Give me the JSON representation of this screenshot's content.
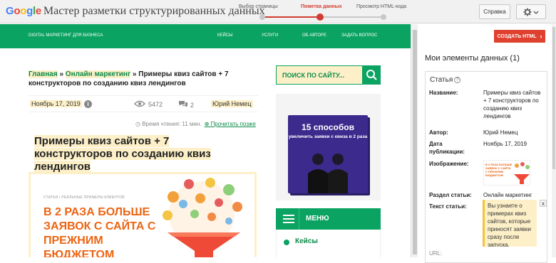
{
  "topbar": {
    "brand_google": "Google",
    "brand_title": "Мастер разметки структурированных данных",
    "steps": [
      "Выбор страницы",
      "Пометка данных",
      "Просмотр HTML-кода"
    ],
    "help_label": "Справка",
    "active_color": "#d23c30"
  },
  "site": {
    "nav": [
      "DIGITAL МАРКЕТИНГ ДЛЯ БИЗНЕСА",
      "КЕЙСЫ",
      "УСЛУГИ",
      "ОБ АВТОРЕ",
      "ЗАДАТЬ ВОПРОС"
    ],
    "brand_color": "#0ba361",
    "breadcrumb": {
      "home": "Главная",
      "sep1": " » ",
      "category": "Онлайн маркетинг",
      "sep2": " » ",
      "current": "Примеры квиз сайтов + 7 конструкторов по созданию квиз лендингов"
    },
    "meta": {
      "date": "Ноябрь 17, 2019",
      "views": "5472",
      "comments": "2",
      "author": "Юрий Немец"
    },
    "read_time": "Время чтения: 11 мин.",
    "read_later": "Прочитать позже",
    "article_title": "Примеры квиз сайтов + 7 конструкторов по созданию квиз лендингов",
    "hero": {
      "kicker": "СТАТЬЯ • РЕАЛЬНЫЕ ПРИМЕРЫ КЛИЕНТОВ",
      "headline": "В 2 РАЗА БОЛЬШЕ ЗАЯВОК С САЙТА С ПРЕЖНИМ БЮДЖЕТОМ"
    },
    "search_placeholder": "ПОИСК ПО САЙТУ...",
    "book": {
      "number": "15 способов",
      "subtitle": "увеличить заявки с квиза в 2 раза"
    },
    "menu_label": "МЕНЮ",
    "menu_item": "Кейсы"
  },
  "panel": {
    "create_html": "СОЗДАТЬ HTML",
    "title": "Мои элементы данных (1)",
    "card_title": "Статья",
    "fields": {
      "name_label": "Название:",
      "name_value": "Примеры квиз сайтов + 7 конструкторов по созданию квиз лендингов",
      "author_label": "Автор:",
      "author_value": "Юрий Немец",
      "date_label": "Дата публикации:",
      "date_value": "Ноябрь 17, 2019",
      "image_label": "Изображение:",
      "section_label": "Раздел статьи:",
      "section_value": "Онлайн маркетинг",
      "text_label": "Текст статьи:",
      "text_value": "Вы узнаете о примерах квиз сайтов, которые приносят заявки сразу после запуска.",
      "url_label": "URL:",
      "close": "x"
    },
    "thumb_text": "В 2 РАЗА БОЛЬШЕ ЗАЯВОК С САЙТА С ПРЕЖНИМ БЮДЖЕТОМ"
  }
}
